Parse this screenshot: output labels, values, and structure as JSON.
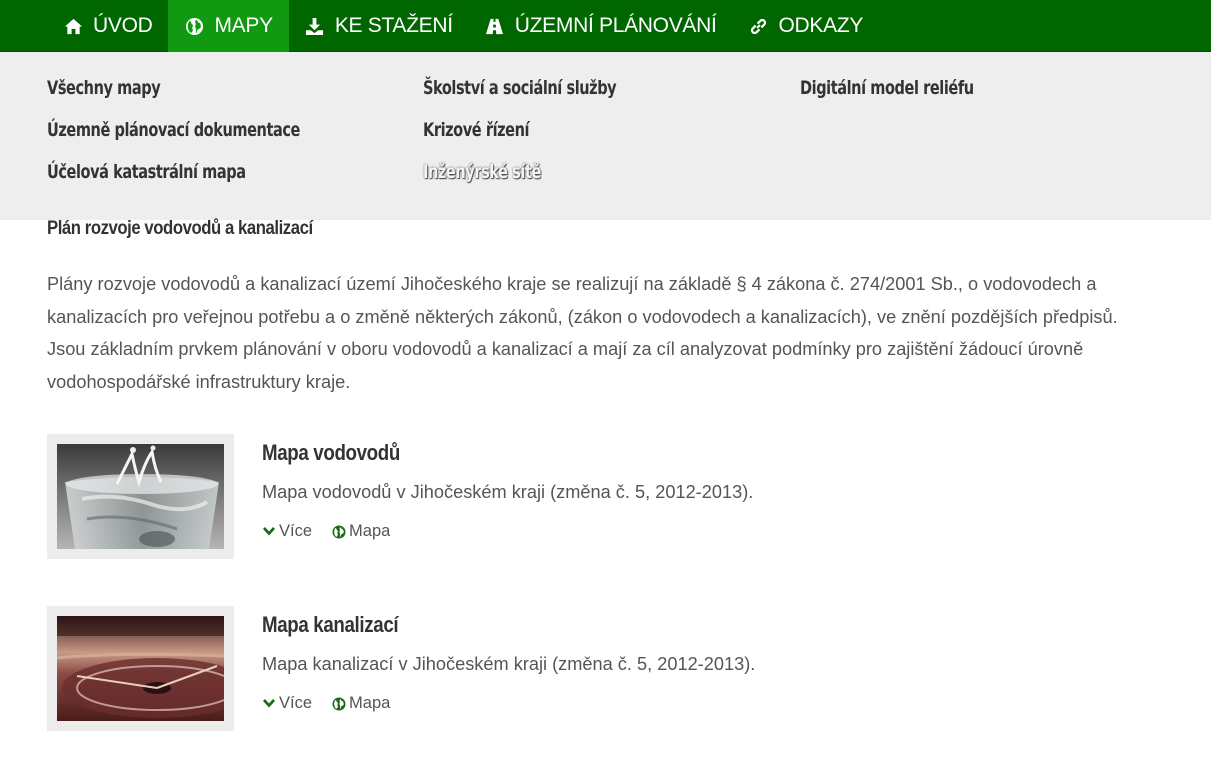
{
  "nav": {
    "items": [
      {
        "label": "ÚVOD",
        "icon": "home-icon"
      },
      {
        "label": "MAPY",
        "icon": "globe-icon",
        "active": true
      },
      {
        "label": "KE STAŽENÍ",
        "icon": "download-icon"
      },
      {
        "label": "ÚZEMNÍ PLÁNOVÁNÍ",
        "icon": "road-icon"
      },
      {
        "label": "ODKAZY",
        "icon": "link-icon"
      }
    ],
    "colors": {
      "bar": "#006600",
      "active": "#119911"
    }
  },
  "megamenu": {
    "col1": [
      "Všechny mapy",
      "Územně plánovací dokumentace",
      "Účelová katastrální mapa"
    ],
    "col2": [
      "Školství a sociální služby",
      "Krizové řízení",
      "Inženýrské sítě"
    ],
    "col3": [
      "Digitální model reliéfu"
    ]
  },
  "section": {
    "title": "Plán rozvoje vodovodů a kanalizací",
    "intro": "Plány rozvoje vodovodů a kanalizací území Jihočeského kraje se realizují na základě § 4 zákona č. 274/2001 Sb., o vodovodech a kanalizacích pro veřejnou potřebu a o změně některých zákonů, (zákon o vodovodech a kanalizacích), ve znění pozdějších předpisů. Jsou základním prvkem plánování v oboru vodovodů a kanalizací a mají za cíl analyzovat podmínky pro zajištění žádoucí úrovně vodohospodářské infrastruktury kraje."
  },
  "cards": [
    {
      "title": "Mapa vodovodů",
      "desc": "Mapa vodovodů v Jihočeském kraji (změna č. 5, 2012-2013).",
      "more": "Více",
      "map": "Mapa"
    },
    {
      "title": "Mapa kanalizací",
      "desc": "Mapa kanalizací v Jihočeském kraji (změna č. 5, 2012-2013).",
      "more": "Více",
      "map": "Mapa"
    }
  ]
}
